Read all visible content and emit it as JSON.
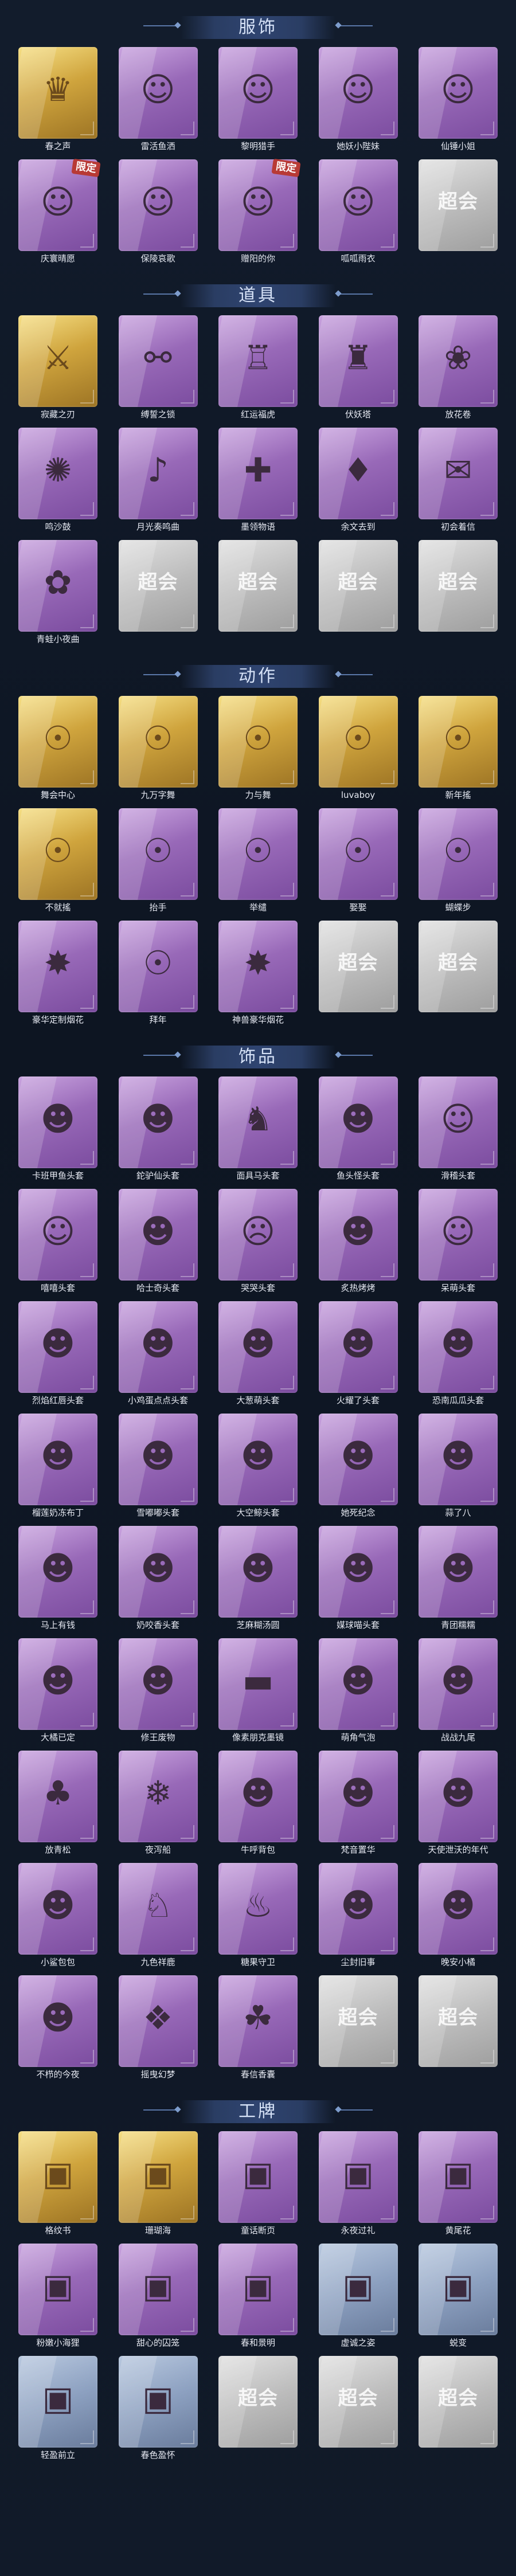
{
  "sections": [
    {
      "title": "服饰",
      "items": [
        {
          "label": "春之声",
          "style": "gold",
          "icon": "portrait-icon",
          "glyph": "♛"
        },
        {
          "label": "雷活鱼洒",
          "style": "purple",
          "icon": "portrait-icon",
          "glyph": "☺"
        },
        {
          "label": "黎明猎手",
          "style": "purple",
          "icon": "portrait-icon",
          "glyph": "☺"
        },
        {
          "label": "她妖小陛妹",
          "style": "purple",
          "icon": "portrait-icon",
          "glyph": "☺"
        },
        {
          "label": "仙锤小姐",
          "style": "purple",
          "icon": "portrait-icon",
          "glyph": "☺"
        },
        {
          "label": "庆寰晴愿",
          "style": "purple",
          "icon": "portrait-icon",
          "glyph": "☺",
          "badge": "限定"
        },
        {
          "label": "保陵哀歌",
          "style": "purple",
          "icon": "portrait-icon",
          "glyph": "☺"
        },
        {
          "label": "赠阳的你",
          "style": "purple",
          "icon": "portrait-icon",
          "glyph": "☺",
          "badge": "限定"
        },
        {
          "label": "呱呱雨衣",
          "style": "purple",
          "icon": "portrait-icon",
          "glyph": "☺"
        },
        {
          "label": "",
          "style": "gray",
          "icon": "placeholder-logo",
          "glyph": "超会玩"
        }
      ]
    },
    {
      "title": "道具",
      "items": [
        {
          "label": "寂藏之刃",
          "style": "gold",
          "icon": "blade-icon",
          "glyph": "⚔"
        },
        {
          "label": "缚誓之锁",
          "style": "purple",
          "icon": "chain-icon",
          "glyph": "⚯"
        },
        {
          "label": "红运福虎",
          "style": "purple",
          "icon": "tiger-icon",
          "glyph": "♖"
        },
        {
          "label": "伏妖塔",
          "style": "purple",
          "icon": "tower-icon",
          "glyph": "♜"
        },
        {
          "label": "放花卷",
          "style": "purple",
          "icon": "ribbon-icon",
          "glyph": "❀"
        },
        {
          "label": "鸣沙鼓",
          "style": "purple",
          "icon": "dreamcatcher-icon",
          "glyph": "✺"
        },
        {
          "label": "月光奏鸣曲",
          "style": "purple",
          "icon": "microscope-icon",
          "glyph": "♪"
        },
        {
          "label": "墨领物语",
          "style": "purple",
          "icon": "case-icon",
          "glyph": "✚"
        },
        {
          "label": "余文去到",
          "style": "purple",
          "icon": "lantern-icon",
          "glyph": "♦"
        },
        {
          "label": "初会着信",
          "style": "purple",
          "icon": "scroll-icon",
          "glyph": "✉"
        },
        {
          "label": "青蛙小夜曲",
          "style": "purple",
          "icon": "frog-icon",
          "glyph": "✿"
        },
        {
          "label": "",
          "style": "gray",
          "icon": "placeholder-logo",
          "glyph": "超会玩"
        },
        {
          "label": "",
          "style": "gray",
          "icon": "placeholder-logo",
          "glyph": "超会玩"
        },
        {
          "label": "",
          "style": "gray",
          "icon": "placeholder-logo",
          "glyph": "超会玩"
        },
        {
          "label": "",
          "style": "gray",
          "icon": "placeholder-logo",
          "glyph": "超会玩"
        }
      ]
    },
    {
      "title": "动作",
      "items": [
        {
          "label": "舞会中心",
          "style": "gold",
          "icon": "dance-pose-icon",
          "glyph": "☉"
        },
        {
          "label": "九万字舞",
          "style": "gold",
          "icon": "dance-pose-icon",
          "glyph": "☉"
        },
        {
          "label": "力与舞",
          "style": "gold",
          "icon": "dance-pose-icon",
          "glyph": "☉"
        },
        {
          "label": "luvaboy",
          "style": "gold",
          "icon": "dance-pose-icon",
          "glyph": "☉"
        },
        {
          "label": "新年搖",
          "style": "gold",
          "icon": "dance-pose-icon",
          "glyph": "☉"
        },
        {
          "label": "不就搖",
          "style": "gold",
          "icon": "dance-pose-icon",
          "glyph": "☉"
        },
        {
          "label": "抬手",
          "style": "purple",
          "icon": "gesture-icon",
          "glyph": "☉"
        },
        {
          "label": "举缱",
          "style": "purple",
          "icon": "gesture-icon",
          "glyph": "☉"
        },
        {
          "label": "娶娶",
          "style": "purple",
          "icon": "gesture-icon",
          "glyph": "☉"
        },
        {
          "label": "蝴蝶步",
          "style": "purple",
          "icon": "gesture-icon",
          "glyph": "☉"
        },
        {
          "label": "豪华定制烟花",
          "style": "purple",
          "icon": "fireworks-icon",
          "glyph": "✸"
        },
        {
          "label": "拜年",
          "style": "purple",
          "icon": "gesture-icon",
          "glyph": "☉"
        },
        {
          "label": "神兽豪华烟花",
          "style": "purple",
          "icon": "fireworks-icon",
          "glyph": "✸"
        },
        {
          "label": "",
          "style": "gray",
          "icon": "placeholder-logo",
          "glyph": "超会玩"
        },
        {
          "label": "",
          "style": "gray",
          "icon": "placeholder-logo",
          "glyph": "超会玩"
        }
      ]
    },
    {
      "title": "饰品",
      "items": [
        {
          "label": "卡班甲鱼头套",
          "style": "purple",
          "icon": "head-icon",
          "glyph": "☻"
        },
        {
          "label": "鉈驴仙头套",
          "style": "purple",
          "icon": "head-icon",
          "glyph": "☻"
        },
        {
          "label": "面具马头套",
          "style": "purple",
          "icon": "head-icon",
          "glyph": "♞"
        },
        {
          "label": "鱼头怪头套",
          "style": "purple",
          "icon": "head-icon",
          "glyph": "☻"
        },
        {
          "label": "滑稽头套",
          "style": "purple",
          "icon": "head-icon",
          "glyph": "☺"
        },
        {
          "label": "嘻嘻头套",
          "style": "purple",
          "icon": "head-icon",
          "glyph": "☺"
        },
        {
          "label": "哈士奇头套",
          "style": "purple",
          "icon": "head-icon",
          "glyph": "☻"
        },
        {
          "label": "哭哭头套",
          "style": "purple",
          "icon": "head-icon",
          "glyph": "☹"
        },
        {
          "label": "炙热烤烤",
          "style": "purple",
          "icon": "head-icon",
          "glyph": "☻"
        },
        {
          "label": "呆萌头套",
          "style": "purple",
          "icon": "head-icon",
          "glyph": "☺"
        },
        {
          "label": "烈焰红唇头套",
          "style": "purple",
          "icon": "head-icon",
          "glyph": "☻"
        },
        {
          "label": "小鸡蛋点点头套",
          "style": "purple",
          "icon": "head-icon",
          "glyph": "☻"
        },
        {
          "label": "大葱萌头套",
          "style": "purple",
          "icon": "head-icon",
          "glyph": "☻"
        },
        {
          "label": "火耀了头套",
          "style": "purple",
          "icon": "head-icon",
          "glyph": "☻"
        },
        {
          "label": "恐南瓜瓜头套",
          "style": "purple",
          "icon": "head-icon",
          "glyph": "☻"
        },
        {
          "label": "榴莲奶冻布丁",
          "style": "purple",
          "icon": "head-icon",
          "glyph": "☻"
        },
        {
          "label": "雪嘟嘟头套",
          "style": "purple",
          "icon": "head-icon",
          "glyph": "☻"
        },
        {
          "label": "大空鲸头套",
          "style": "purple",
          "icon": "head-icon",
          "glyph": "☻"
        },
        {
          "label": "她死纪念",
          "style": "purple",
          "icon": "head-icon",
          "glyph": "☻"
        },
        {
          "label": "蒜了八",
          "style": "purple",
          "icon": "head-icon",
          "glyph": "☻"
        },
        {
          "label": "马上有钱",
          "style": "purple",
          "icon": "head-icon",
          "glyph": "☻"
        },
        {
          "label": "奶咬香头套",
          "style": "purple",
          "icon": "head-icon",
          "glyph": "☻"
        },
        {
          "label": "芝麻糊汤圆",
          "style": "purple",
          "icon": "head-icon",
          "glyph": "☻"
        },
        {
          "label": "媒球喵头套",
          "style": "purple",
          "icon": "head-icon",
          "glyph": "☻"
        },
        {
          "label": "青团糯糯",
          "style": "purple",
          "icon": "head-icon",
          "glyph": "☻"
        },
        {
          "label": "大橘已定",
          "style": "purple",
          "icon": "head-icon",
          "glyph": "☻"
        },
        {
          "label": "修王废物",
          "style": "purple",
          "icon": "head-icon",
          "glyph": "☻"
        },
        {
          "label": "像素朋克墨镜",
          "style": "purple",
          "icon": "sunglasses-icon",
          "glyph": "▬"
        },
        {
          "label": "萌角气泡",
          "style": "purple",
          "icon": "head-icon",
          "glyph": "☻"
        },
        {
          "label": "战战九尾",
          "style": "purple",
          "icon": "head-icon",
          "glyph": "☻"
        },
        {
          "label": "放青松",
          "style": "purple",
          "icon": "tree-icon",
          "glyph": "♣"
        },
        {
          "label": "夜泻船",
          "style": "purple",
          "icon": "ornament-icon",
          "glyph": "❄"
        },
        {
          "label": "牛呼背包",
          "style": "purple",
          "icon": "backpack-icon",
          "glyph": "☻"
        },
        {
          "label": "梵音置华",
          "style": "purple",
          "icon": "head-icon",
          "glyph": "☻"
        },
        {
          "label": "天使泄沃的年代",
          "style": "purple",
          "icon": "head-icon",
          "glyph": "☻"
        },
        {
          "label": "小鲨包包",
          "style": "purple",
          "icon": "shark-icon",
          "glyph": "☻"
        },
        {
          "label": "九色祥鹿",
          "style": "purple",
          "icon": "deer-icon",
          "glyph": "♘"
        },
        {
          "label": "糖果守卫",
          "style": "purple",
          "icon": "candy-icon",
          "glyph": "♨"
        },
        {
          "label": "尘封旧事",
          "style": "purple",
          "icon": "head-icon",
          "glyph": "☻"
        },
        {
          "label": "晚安小橘",
          "style": "purple",
          "icon": "head-icon",
          "glyph": "☻"
        },
        {
          "label": "不栉的今夜",
          "style": "purple",
          "icon": "plush-icon",
          "glyph": "☻"
        },
        {
          "label": "摇曳幻梦",
          "style": "purple",
          "icon": "pendant-icon",
          "glyph": "❖"
        },
        {
          "label": "春信香囊",
          "style": "purple",
          "icon": "sachet-icon",
          "glyph": "☘"
        },
        {
          "label": "",
          "style": "gray",
          "icon": "placeholder-logo",
          "glyph": "超会玩"
        },
        {
          "label": "",
          "style": "gray",
          "icon": "placeholder-logo",
          "glyph": "超会玩"
        }
      ]
    },
    {
      "title": "工牌",
      "items": [
        {
          "label": "格纹书",
          "style": "gold",
          "icon": "badge-icon",
          "glyph": "▣"
        },
        {
          "label": "珊瑚海",
          "style": "gold",
          "icon": "badge-icon",
          "glyph": "▣"
        },
        {
          "label": "童话断页",
          "style": "purple",
          "icon": "badge-icon",
          "glyph": "▣"
        },
        {
          "label": "永夜过礼",
          "style": "purple",
          "icon": "badge-icon",
          "glyph": "▣"
        },
        {
          "label": "黄尾花",
          "style": "purple",
          "icon": "badge-icon",
          "glyph": "▣"
        },
        {
          "label": "粉嫩小海狸",
          "style": "purple",
          "icon": "badge-icon",
          "glyph": "▣"
        },
        {
          "label": "甜心的囚笼",
          "style": "purple",
          "icon": "badge-icon",
          "glyph": "▣"
        },
        {
          "label": "春和景明",
          "style": "purple",
          "icon": "badge-icon",
          "glyph": "▣"
        },
        {
          "label": "虚诚之姿",
          "style": "silver",
          "icon": "badge-icon",
          "glyph": "▣"
        },
        {
          "label": "蜕变",
          "style": "silver",
          "icon": "badge-icon",
          "glyph": "▣"
        },
        {
          "label": "轻盈前立",
          "style": "silver",
          "icon": "badge-icon",
          "glyph": "▣"
        },
        {
          "label": "春色盈怀",
          "style": "silver",
          "icon": "badge-icon",
          "glyph": "▣"
        },
        {
          "label": "",
          "style": "gray",
          "icon": "placeholder-logo",
          "glyph": "超会玩"
        },
        {
          "label": "",
          "style": "gray",
          "icon": "placeholder-logo",
          "glyph": "超会玩"
        },
        {
          "label": "",
          "style": "gray",
          "icon": "placeholder-logo",
          "glyph": "超会玩"
        }
      ]
    }
  ]
}
